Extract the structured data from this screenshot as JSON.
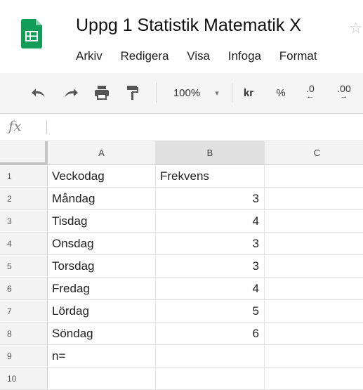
{
  "doc": {
    "title": "Uppg 1 Statistik Matematik X"
  },
  "menu": [
    "Arkiv",
    "Redigera",
    "Visa",
    "Infoga",
    "Format"
  ],
  "toolbar": {
    "zoom": "100%",
    "currency": "kr",
    "percent": "%",
    "dec_decrease": ".0",
    "dec_increase": ".00"
  },
  "formula": {
    "fx_label": "fx"
  },
  "columns": [
    "A",
    "B",
    "C"
  ],
  "rows": [
    {
      "n": "1",
      "a": "Veckodag",
      "b": "Frekvens",
      "b_num": false
    },
    {
      "n": "2",
      "a": "Måndag",
      "b": "3",
      "b_num": true
    },
    {
      "n": "3",
      "a": "Tisdag",
      "b": "4",
      "b_num": true
    },
    {
      "n": "4",
      "a": "Onsdag",
      "b": "3",
      "b_num": true
    },
    {
      "n": "5",
      "a": "Torsdag",
      "b": "3",
      "b_num": true
    },
    {
      "n": "6",
      "a": "Fredag",
      "b": "4",
      "b_num": true
    },
    {
      "n": "7",
      "a": "Lördag",
      "b": "5",
      "b_num": true
    },
    {
      "n": "8",
      "a": "Söndag",
      "b": "6",
      "b_num": true
    },
    {
      "n": "9",
      "a": "n=",
      "b": "",
      "b_num": false
    },
    {
      "n": "10",
      "a": "",
      "b": "",
      "b_num": false
    }
  ],
  "colors": {
    "sheets_green": "#0f9d58",
    "selected_col_header": "#e0e0e0"
  }
}
